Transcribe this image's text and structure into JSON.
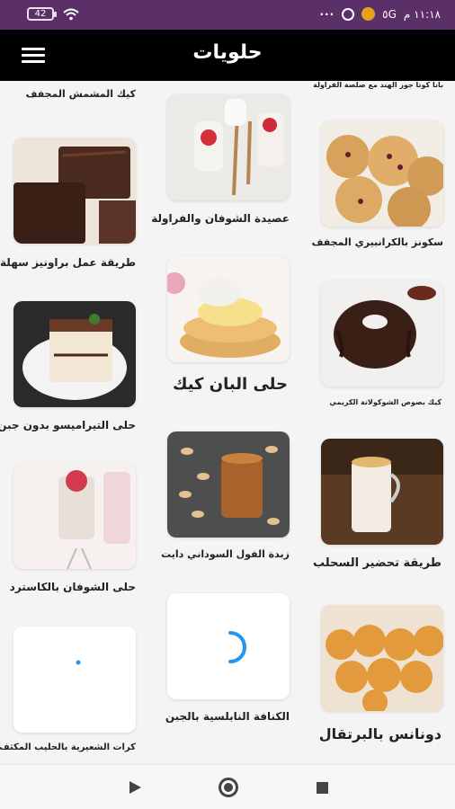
{
  "status_bar": {
    "battery": "42",
    "time": "١١:١٨ م",
    "network": "٥G"
  },
  "app_bar": {
    "title": "حلويات"
  },
  "recipes": {
    "top_left": "كيك المشمش المجفف",
    "top_right": "بانا كوتا جوز الهند مع صلصة الفراولة",
    "brownies": "طريقة عمل براونيز سهلة",
    "oat_strawberry": "عصيدة الشوفان والفراولة",
    "cranberry_scones": "سكونز بالكرانبيري المجفف",
    "tiramisu": "حلى التيراميسو بدون جبن",
    "pancake": "حلى البان كيك",
    "choc_cake": "كيك بصوص الشوكولاتة الكريمي",
    "oat_custard": "حلى الشوفان بالكاسترد",
    "peanut_butter": "زبدة الفول السوداني دايت",
    "sahlab": "طريقة تحضير السحلب",
    "vermicelli": "كرات الشعيرية بالحليب المكثف",
    "knafeh": "الكنافة النابلسية بالجبن",
    "orange_donuts": "دونانس بالبرتقال"
  },
  "colors": {
    "status_bar": "#5b2f67",
    "app_bar": "#000000",
    "spinner": "#2196f3"
  }
}
